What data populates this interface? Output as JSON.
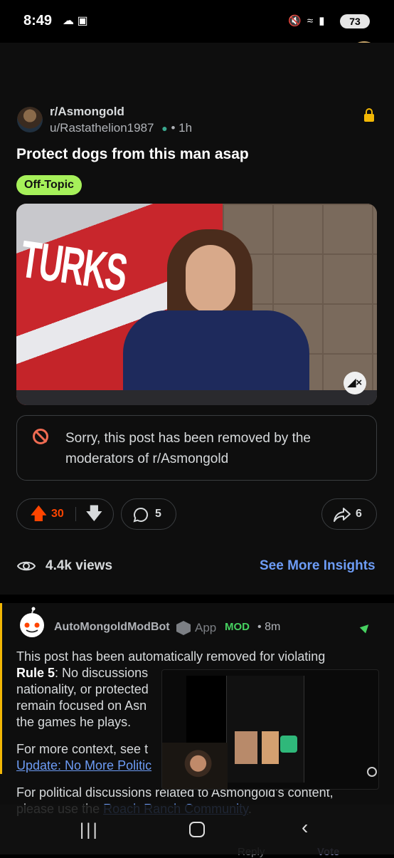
{
  "status_bar": {
    "time": "8:49",
    "battery": "73"
  },
  "post": {
    "subreddit": "r/Asmongold",
    "username": "u/Rastathelion1987",
    "age": "1h",
    "title": "Protect dogs from this man asap",
    "flair": "Off-Topic",
    "video_text": "TURKS",
    "removed_message": "Sorry, this post has been removed by the moderators of r/Asmongold",
    "upvotes": "30",
    "comments": "5",
    "shares": "6",
    "views": "4.4k views",
    "insights_link": "See More Insights"
  },
  "comment": {
    "author": "AutoMongoldModBot",
    "app_label": "App",
    "mod_label": "MOD",
    "age": "8m",
    "line1": "This post has been automatically removed for violating",
    "rule": "Rule 5",
    "line2a": ": No discussions",
    "line3": "nationality, or protected",
    "line4": "remain focused on Asn",
    "line5": "the games he plays.",
    "context_prefix": "For more context, see t",
    "context_link": "Update: No More Politic",
    "political_line": "For political discussions related to Asmongold's content,",
    "please_use": "please use the ",
    "community_link": "Roach Ranch Community",
    "period": ".",
    "reply_label": "Reply",
    "vote_label": "Vote"
  },
  "colors": {
    "accent": "#6d9cf5",
    "upvote": "#ff4500",
    "flair": "#a6f05a",
    "mod": "#46d160"
  }
}
